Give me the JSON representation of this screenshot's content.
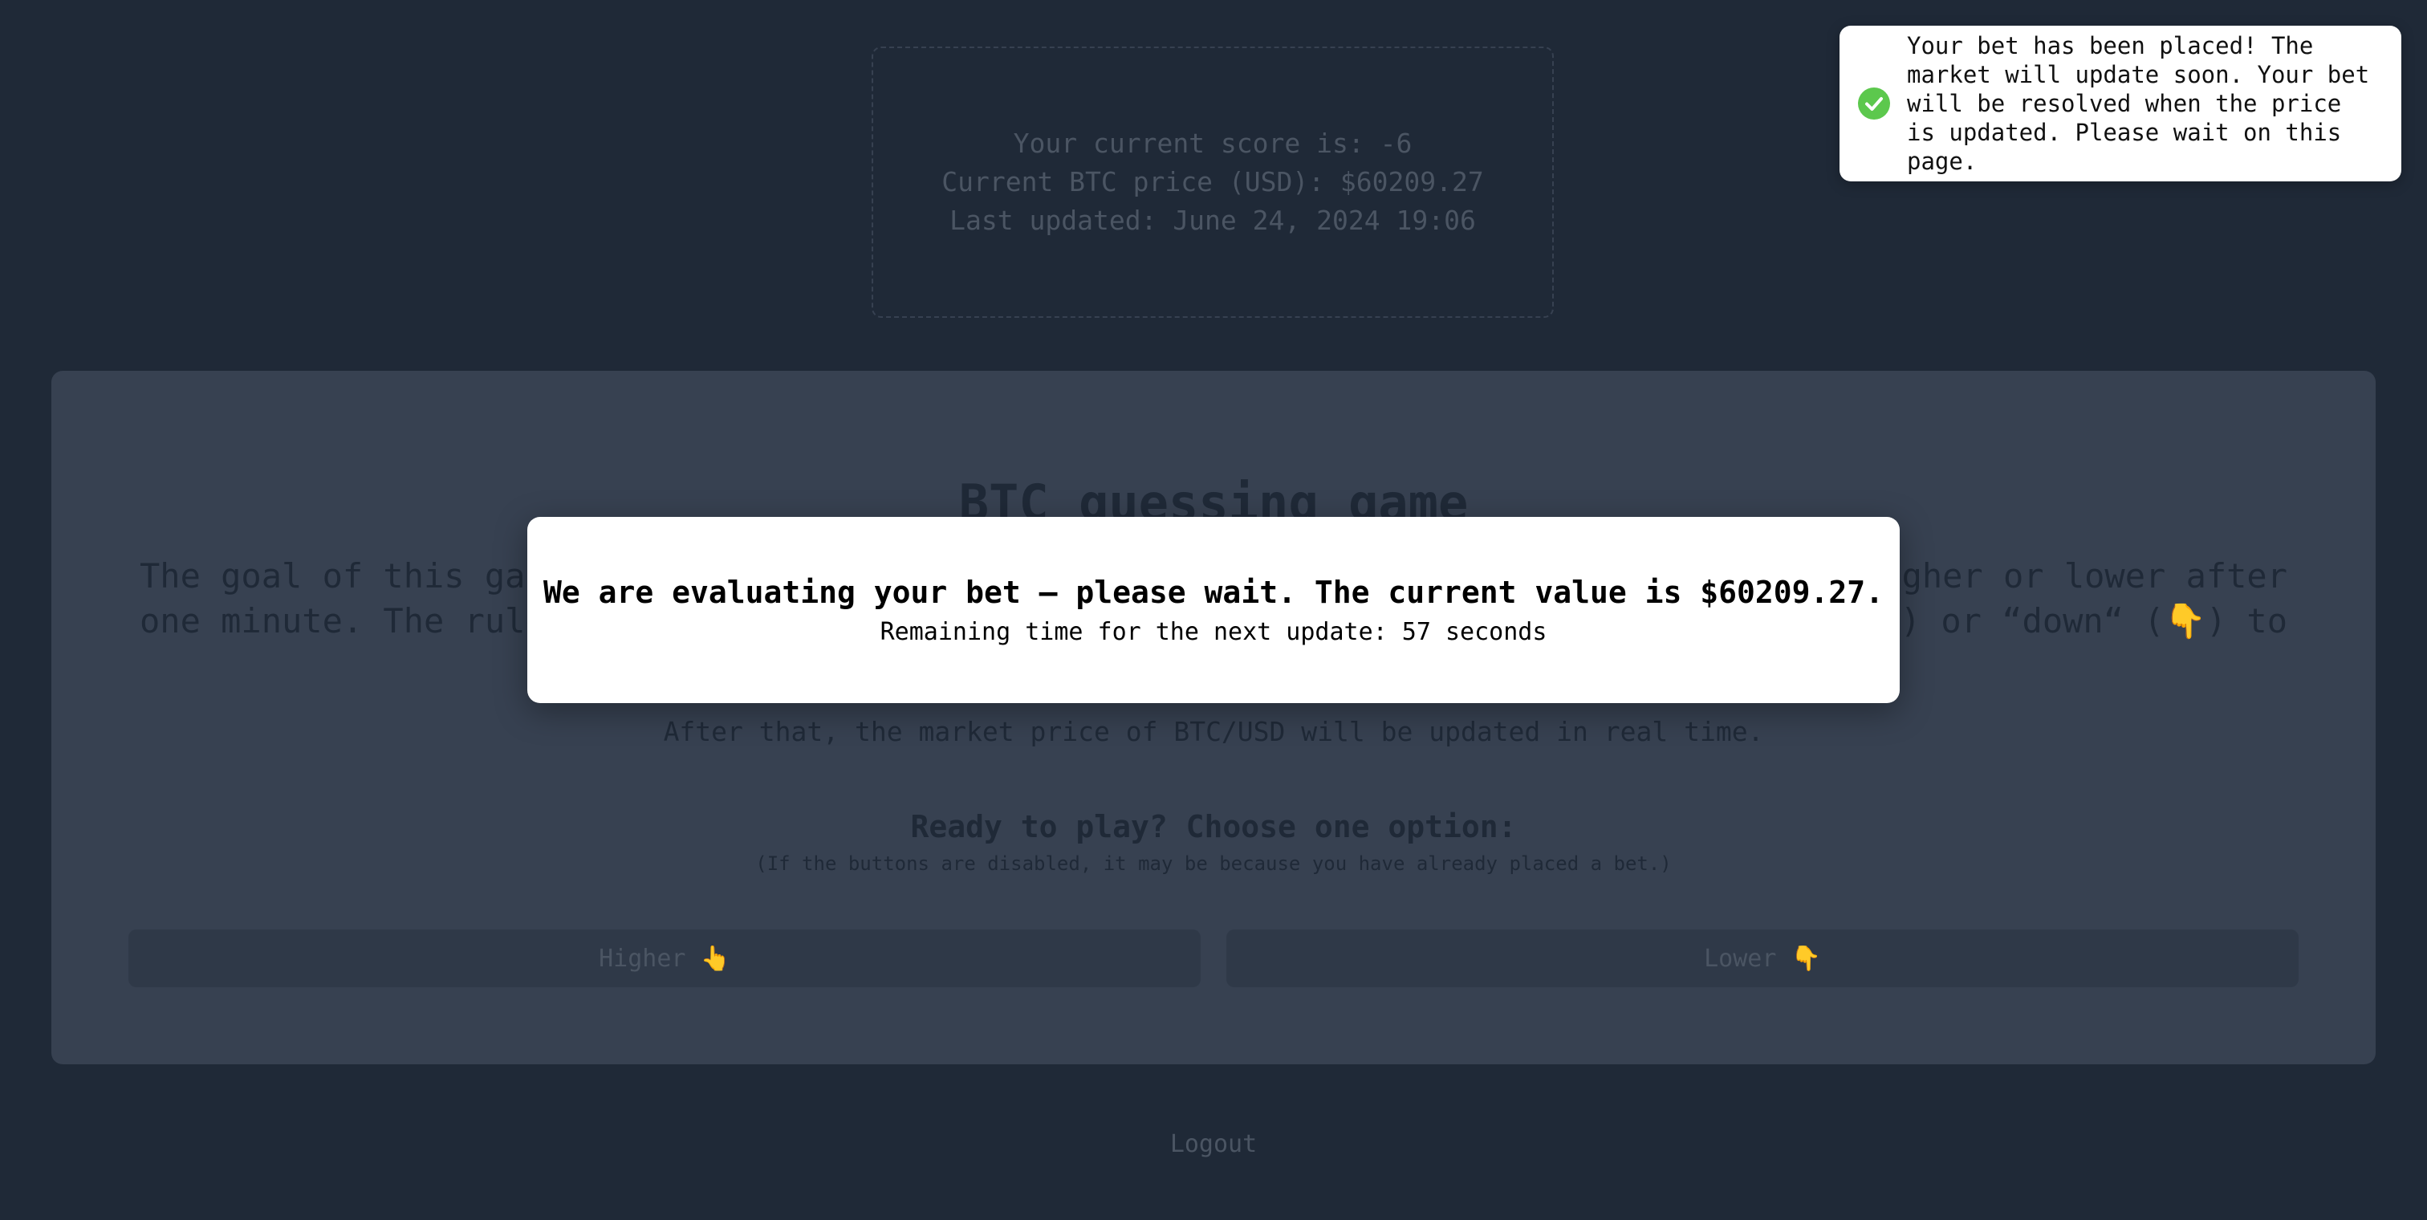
{
  "score_box": {
    "score_line": "Your current score is: -6",
    "price_line": "Current BTC price (USD): $60209.27",
    "updated_line": "Last updated: June 24, 2024 19:06"
  },
  "card": {
    "title": "BTC guessing game",
    "description_line1": "The goal of this ga",
    "description_line1_end": "gher or lower after",
    "description_line2": "one minute. The rule",
    "description_line2_end": ") or “down“ (👇) to",
    "after_text": "After that, the market price of BTC/USD will be updated in real time.",
    "ready_text": "Ready to play? Choose one option:",
    "note_text": "(If the buttons are disabled, it may be because you have already placed a bet.)",
    "higher_label": "Higher 👆",
    "lower_label": "Lower 👇"
  },
  "logout_label": "Logout",
  "modal": {
    "title": "We are evaluating your bet — please wait. The current value is $60209.27.",
    "subtitle": "Remaining time for the next update: 57 seconds"
  },
  "toast": {
    "icon": "check-circle-icon",
    "message": "Your bet has been placed! The market will update soon. Your bet will be resolved when the price is updated. Please wait on this page.",
    "color": "#4ade80"
  },
  "colors": {
    "background": "#1f2937",
    "card": "#374151",
    "success": "#5cc84d"
  }
}
